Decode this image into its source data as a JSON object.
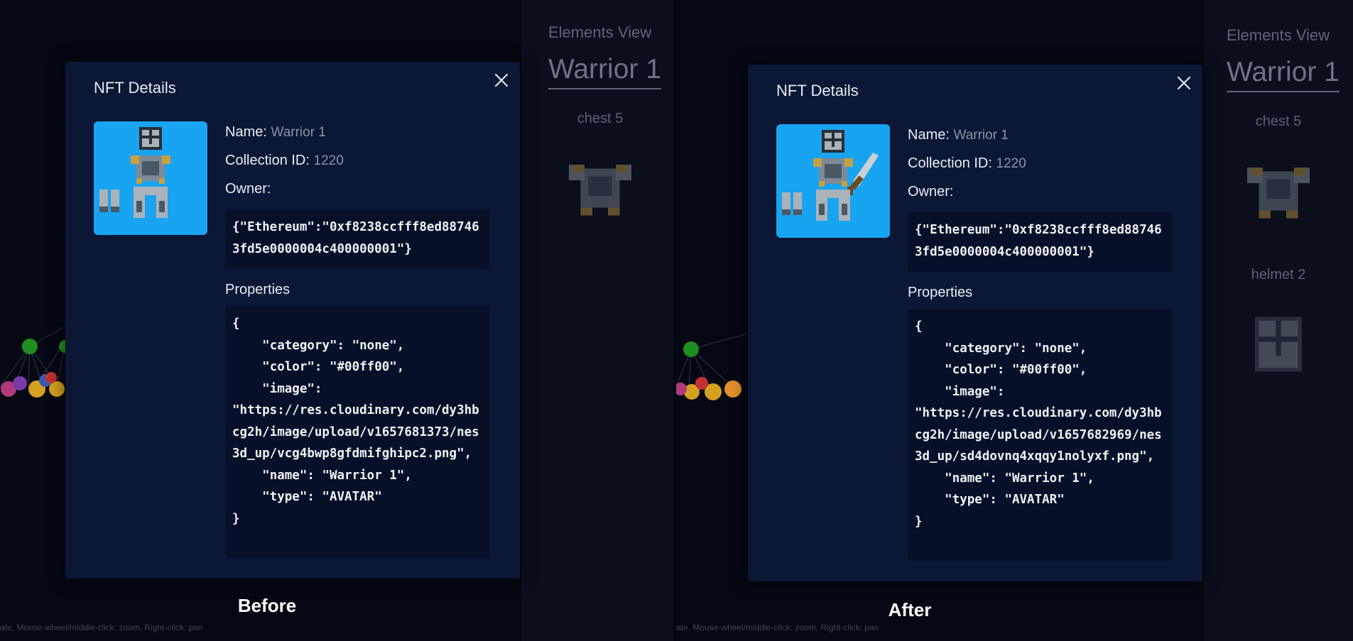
{
  "panels": [
    {
      "caption": "Before",
      "hint": "ate, Mouse-wheel/middle-click: zoom, Right-click: pan",
      "elements_view": {
        "title": "Elements View",
        "name": "Warrior 1",
        "items": [
          "chest 5"
        ]
      },
      "modal": {
        "title": "NFT Details",
        "name_label": "Name:",
        "name_value": "Warrior 1",
        "collection_label": "Collection ID:",
        "collection_value": "1220",
        "owner_label": "Owner:",
        "owner_value": "{\"Ethereum\":\"0xf8238ccfff8ed887463fd5e0000004c400000001\"}",
        "properties_label": "Properties",
        "properties_value": "{\n    \"category\": \"none\",\n    \"color\": \"#00ff00\",\n    \"image\": \n\"https://res.cloudinary.com/dy3hbcg2h/image/upload/v1657681373/nes3d_up/vcg4bwp8gfdmifghipc2.png\",\n    \"name\": \"Warrior 1\",\n    \"type\": \"AVATAR\"\n}",
        "has_sword": false
      }
    },
    {
      "caption": "After",
      "hint": "ate, Mouse-wheel/middle-click: zoom, Right-click: pan",
      "elements_view": {
        "title": "Elements View",
        "name": "Warrior 1",
        "items": [
          "chest 5",
          "helmet 2"
        ]
      },
      "modal": {
        "title": "NFT Details",
        "name_label": "Name:",
        "name_value": "Warrior 1",
        "collection_label": "Collection ID:",
        "collection_value": "1220",
        "owner_label": "Owner:",
        "owner_value": "{\"Ethereum\":\"0xf8238ccfff8ed887463fd5e0000004c400000001\"}",
        "properties_label": "Properties",
        "properties_value": "{\n    \"category\": \"none\",\n    \"color\": \"#00ff00\",\n    \"image\": \n\"https://res.cloudinary.com/dy3hbcg2h/image/upload/v1657682969/nes3d_up/sd4dovnq4xqqy1nolyxf.png\",\n    \"name\": \"Warrior 1\",\n    \"type\": \"AVATAR\"\n}",
        "has_sword": true
      }
    }
  ],
  "colors": {
    "modal_bg": "#0b1735",
    "code_bg": "#081029",
    "thumb_bg": "#18a4f0",
    "graph_node_green": "#1f8f1f"
  },
  "icons": [
    "close-icon",
    "armor-avatar-icon",
    "sword-icon",
    "chest-armor-icon",
    "helmet-icon"
  ]
}
